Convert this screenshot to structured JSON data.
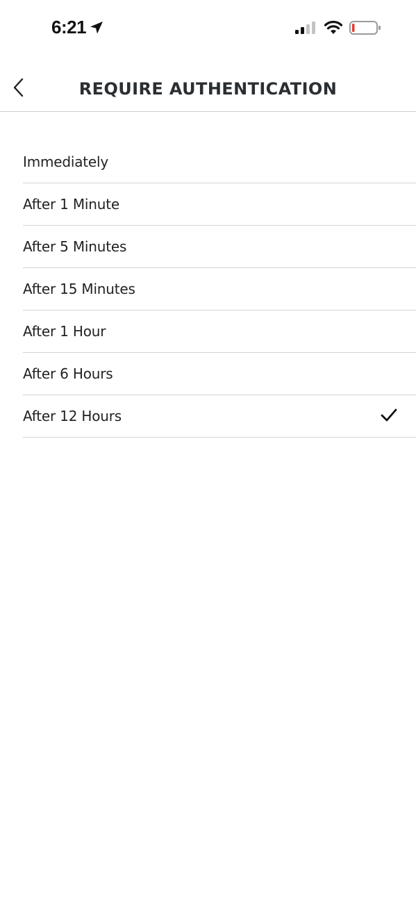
{
  "status_bar": {
    "time": "6:21",
    "icons": [
      "location-arrow-icon",
      "cellular-signal-icon",
      "wifi-icon",
      "battery-low-icon"
    ],
    "battery_color": "#e53b30"
  },
  "header": {
    "title": "REQUIRE AUTHENTICATION",
    "back_icon": "chevron-left-icon"
  },
  "options": [
    {
      "label": "Immediately",
      "selected": false
    },
    {
      "label": "After 1 Minute",
      "selected": false
    },
    {
      "label": "After 5 Minutes",
      "selected": false
    },
    {
      "label": "After 15 Minutes",
      "selected": false
    },
    {
      "label": "After 1 Hour",
      "selected": false
    },
    {
      "label": "After 6 Hours",
      "selected": false
    },
    {
      "label": "After 12 Hours",
      "selected": true
    }
  ],
  "selected_icon": "checkmark-icon"
}
